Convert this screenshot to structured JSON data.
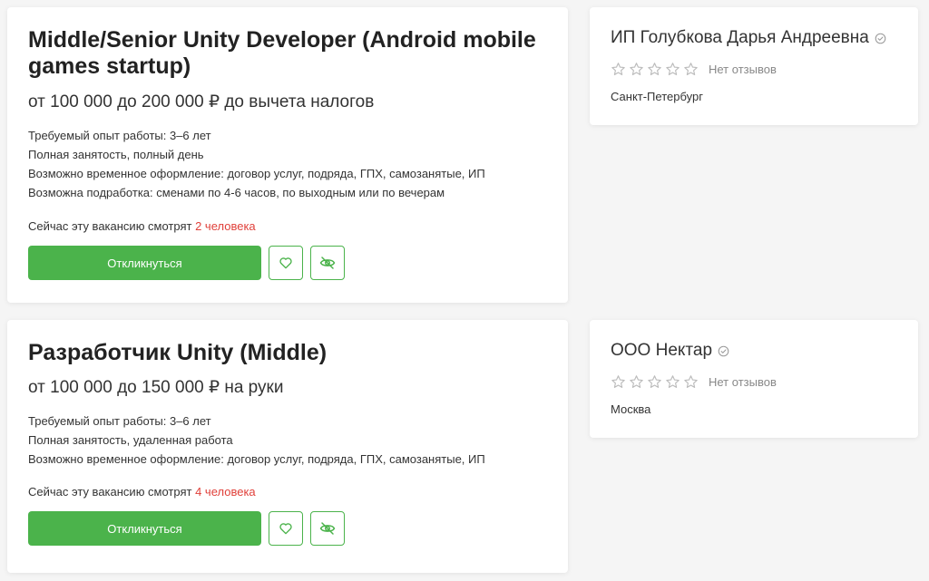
{
  "vacancies": [
    {
      "title": "Middle/Senior Unity Developer (Android mobile games startup)",
      "salary": "от 100 000 до 200 000 ₽ до вычета налогов",
      "details": [
        "Требуемый опыт работы: 3–6 лет",
        "Полная занятость, полный день",
        "Возможно временное оформление: договор услуг, подряда, ГПХ, самозанятые, ИП",
        "Возможна подработка: сменами по 4-6 часов, по выходным или по вечерам"
      ],
      "watching_prefix": "Сейчас эту вакансию смотрят ",
      "watching_count": "2 человека",
      "respond_label": "Откликнуться"
    },
    {
      "title": "Разработчик Unity (Middle)",
      "salary": "от 100 000 до 150 000 ₽ на руки",
      "details": [
        "Требуемый опыт работы: 3–6 лет",
        "Полная занятость, удаленная работа",
        "Возможно временное оформление: договор услуг, подряда, ГПХ, самозанятые, ИП"
      ],
      "watching_prefix": "Сейчас эту вакансию смотрят ",
      "watching_count": "4 человека",
      "respond_label": "Откликнуться"
    }
  ],
  "employers": [
    {
      "name": "ИП Голубкова Дарья Андреевна",
      "reviews": "Нет отзывов",
      "city": "Санкт-Петербург",
      "stars": 0
    },
    {
      "name": "ООО Нектар",
      "reviews": "Нет отзывов",
      "city": "Москва",
      "stars": 0
    }
  ],
  "colors": {
    "accent": "#4bb34b",
    "highlight": "#e0403a",
    "star": "#bbbbbb",
    "background": "#f5f5f5"
  },
  "icons": {
    "favorite": "heart-icon",
    "hide": "eye-off-icon",
    "verified": "check-circle-icon",
    "rating": "star-icon"
  }
}
